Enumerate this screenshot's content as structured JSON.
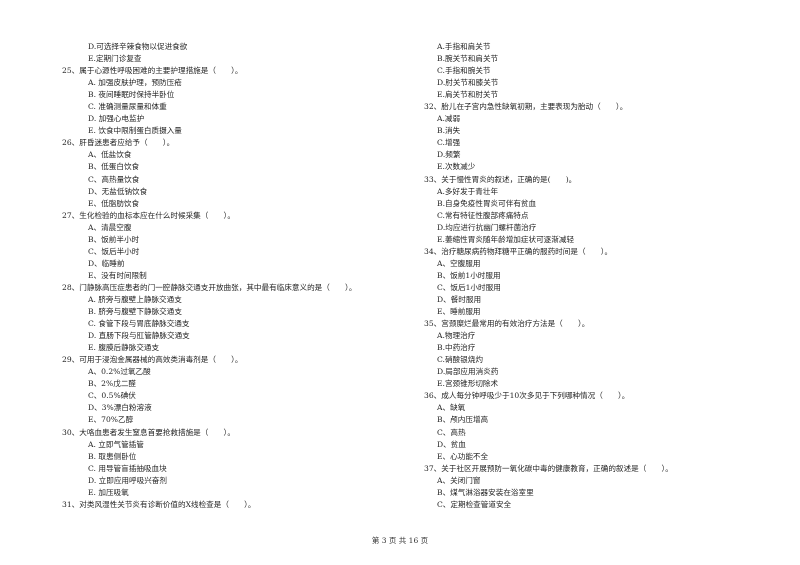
{
  "left": [
    {
      "t": "o",
      "text": "D.可选择辛辣食物以促进食欲"
    },
    {
      "t": "o",
      "text": "E.定期门诊复查"
    },
    {
      "t": "q",
      "text": "25、属于心源性呼吸困难的主要护理措施是（　　）。"
    },
    {
      "t": "o",
      "text": "A. 加强皮肤护理，预防压疮"
    },
    {
      "t": "o",
      "text": "B. 夜间睡眠时保持半卧位"
    },
    {
      "t": "o",
      "text": "C. 准确测量尿量和体重"
    },
    {
      "t": "o",
      "text": "D. 加强心电监护"
    },
    {
      "t": "o",
      "text": "E. 饮食中限制蛋白质摄入量"
    },
    {
      "t": "q",
      "text": "26、肝昏迷患者应给予（　　）。"
    },
    {
      "t": "o",
      "text": "A、低盐饮食"
    },
    {
      "t": "o",
      "text": "B、低蛋白饮食"
    },
    {
      "t": "o",
      "text": "C、高热量饮食"
    },
    {
      "t": "o",
      "text": "D、无盐低钠饮食"
    },
    {
      "t": "o",
      "text": "E、低脂肪饮食"
    },
    {
      "t": "q",
      "text": "27、生化检验的血标本应在什么时候采集（　　）。"
    },
    {
      "t": "o",
      "text": "A、清晨空腹"
    },
    {
      "t": "o",
      "text": "B、饭前半小时"
    },
    {
      "t": "o",
      "text": "C、饭后半小时"
    },
    {
      "t": "o",
      "text": "D、临睡前"
    },
    {
      "t": "o",
      "text": "E、没有时间限制"
    },
    {
      "t": "q",
      "text": "28、门静脉高压症患者的门一腔静脉交通支开放曲张，其中最有临床意义的是（　　）。"
    },
    {
      "t": "o",
      "text": "A. 脐旁与腹壁上静脉交通支"
    },
    {
      "t": "o",
      "text": "B. 脐旁与腹壁下静脉交通支"
    },
    {
      "t": "o",
      "text": "C. 食管下段与胃底静脉交通支"
    },
    {
      "t": "o",
      "text": "D. 直肠下段与肛管静脉交通支"
    },
    {
      "t": "o",
      "text": "E. 腹膜后静脉交通支"
    },
    {
      "t": "q",
      "text": "29、可用于浸泡金属器械的高效类消毒剂是（　　）。"
    },
    {
      "t": "o",
      "text": "A、0.2%过氧乙酸"
    },
    {
      "t": "o",
      "text": "B、2%戊二醛"
    },
    {
      "t": "o",
      "text": "C、0.5%碘伏"
    },
    {
      "t": "o",
      "text": "D、3%漂白粉溶液"
    },
    {
      "t": "o",
      "text": "E、70%乙醇"
    },
    {
      "t": "q",
      "text": "30、大咯血患者发生窒息首要抢救措施是（　　）。"
    },
    {
      "t": "o",
      "text": "A. 立即气管插管"
    },
    {
      "t": "o",
      "text": "B. 取患侧卧位"
    },
    {
      "t": "o",
      "text": "C. 用导管盲插抽吸血块"
    },
    {
      "t": "o",
      "text": "D. 立即应用呼吸兴奋剂"
    },
    {
      "t": "o",
      "text": "E. 加压吸氧"
    },
    {
      "t": "q",
      "text": "31、对类风湿性关节炎有诊断价值的X线检查是（　　）。"
    }
  ],
  "right": [
    {
      "t": "o",
      "text": "A.手指和肩关节"
    },
    {
      "t": "o",
      "text": "B.腕关节和肩关节"
    },
    {
      "t": "o",
      "text": "C.手指和腕关节"
    },
    {
      "t": "o",
      "text": "D.肘关节和膝关节"
    },
    {
      "t": "o",
      "text": "E.肩关节和肘关节"
    },
    {
      "t": "q",
      "text": "32、胎儿在子宫内急性缺氧初期，主要表现为胎动（　　）。"
    },
    {
      "t": "o",
      "text": "A.减弱"
    },
    {
      "t": "o",
      "text": "B.消失"
    },
    {
      "t": "o",
      "text": "C.增强"
    },
    {
      "t": "o",
      "text": "D.频繁"
    },
    {
      "t": "o",
      "text": "E.次数减少"
    },
    {
      "t": "q",
      "text": "33、关于慢性胃炎的叙述，正确的是(　　)。"
    },
    {
      "t": "o",
      "text": "A.多好发于青壮年"
    },
    {
      "t": "o",
      "text": "B.自身免疫性胃炎可伴有贫血"
    },
    {
      "t": "o",
      "text": "C.常有特征性腹部疼痛特点"
    },
    {
      "t": "o",
      "text": "D.均应进行抗幽门螺杆菌治疗"
    },
    {
      "t": "o",
      "text": "E.萎缩性胃炎随年龄增加症状可逐渐减轻"
    },
    {
      "t": "q",
      "text": "34、治疗糖尿病药物拜糖平正确的服药时间是（　　）。"
    },
    {
      "t": "o",
      "text": "A、空腹服用"
    },
    {
      "t": "o",
      "text": "B、饭前1小时服用"
    },
    {
      "t": "o",
      "text": "C、饭后1小时服用"
    },
    {
      "t": "o",
      "text": "D、餐时服用"
    },
    {
      "t": "o",
      "text": "E、睡前服用"
    },
    {
      "t": "q",
      "text": "35、宫颈糜烂最常用的有效治疗方法是（　　）。"
    },
    {
      "t": "o",
      "text": "A.物理治疗"
    },
    {
      "t": "o",
      "text": "B.中药治疗"
    },
    {
      "t": "o",
      "text": "C.硝酸银烧灼"
    },
    {
      "t": "o",
      "text": "D.局部应用消炎药"
    },
    {
      "t": "o",
      "text": "E.宫颈锥形切除术"
    },
    {
      "t": "q",
      "text": "36、成人每分钟呼吸少于10次多见于下列哪种情况（　　）。"
    },
    {
      "t": "o",
      "text": "A、缺氧"
    },
    {
      "t": "o",
      "text": "B、颅内压增高"
    },
    {
      "t": "o",
      "text": "C、高热"
    },
    {
      "t": "o",
      "text": "D、贫血"
    },
    {
      "t": "o",
      "text": "E、心功能不全"
    },
    {
      "t": "q",
      "text": "37、关于社区开展预防一氧化碳中毒的健康教育，正确的叙述是（　　）。"
    },
    {
      "t": "o",
      "text": "A、关闭门窗"
    },
    {
      "t": "o",
      "text": "B、煤气淋浴器安装在浴室里"
    },
    {
      "t": "o",
      "text": "C、定期检查管道安全"
    }
  ],
  "footer": "第 3 页 共 16 页"
}
